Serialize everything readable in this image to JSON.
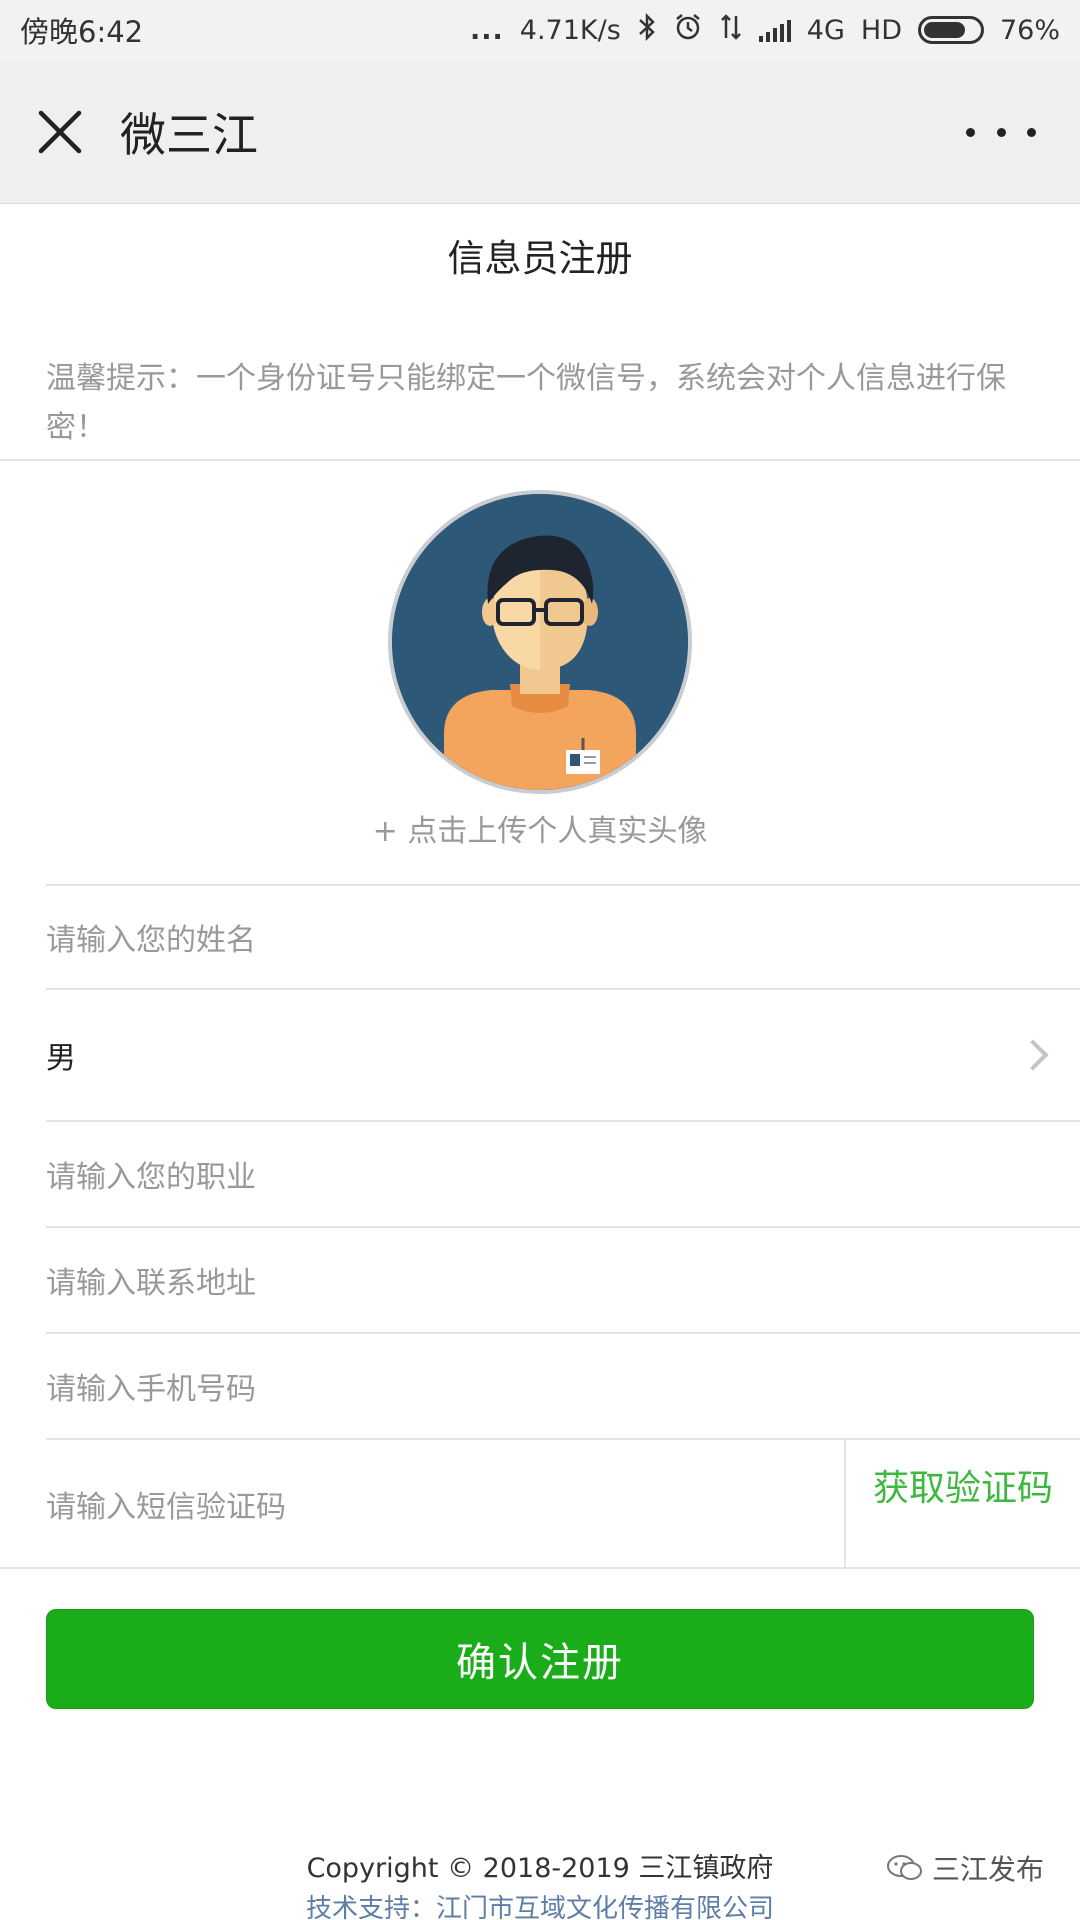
{
  "status_bar": {
    "time": "傍晚6:42",
    "dots": "...",
    "net_speed": "4.71K/s",
    "network": "4G",
    "hd": "HD",
    "battery_pct": "76%",
    "battery_level": 0.76
  },
  "header": {
    "app_title": "微三江",
    "close_icon": "close-icon",
    "more_icon": "more-icon"
  },
  "page": {
    "title": "信息员注册",
    "tip": "温馨提示：一个身份证号只能绑定一个微信号，系统会对个人信息进行保密！",
    "avatar_hint": "+ 点击上传个人真实头像"
  },
  "form": {
    "name_placeholder": "请输入您的姓名",
    "gender_value": "男",
    "job_placeholder": "请输入您的职业",
    "address_placeholder": "请输入联系地址",
    "phone_placeholder": "请输入手机号码",
    "code_placeholder": "请输入短信验证码",
    "get_code_label": "获取验证码",
    "submit_label": "确认注册"
  },
  "footer": {
    "copyright": "Copyright © 2018-2019 三江镇政府",
    "support": "技术支持：江门市互域文化传播有限公司",
    "watermark": "三江发布"
  },
  "colors": {
    "accent_green": "#1aad19",
    "link_green": "#3fb83f",
    "avatar_bg": "#2e5877"
  }
}
